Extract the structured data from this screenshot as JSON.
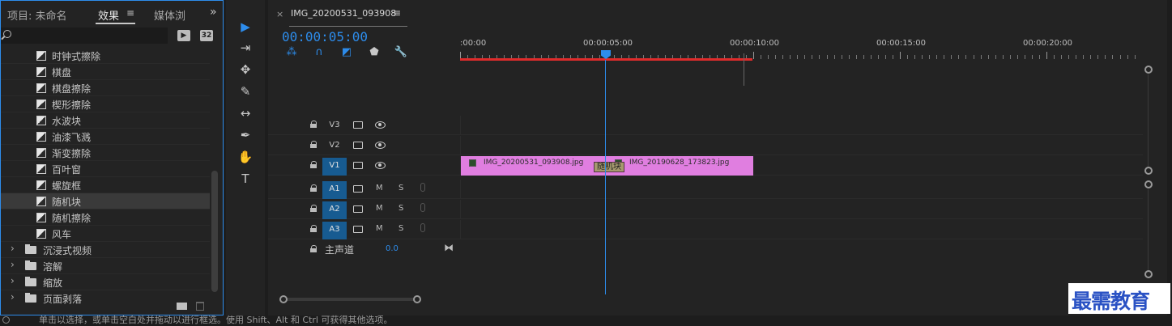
{
  "left_panel": {
    "tabs": [
      {
        "label": "项目: 未命名"
      },
      {
        "label": "效果",
        "menu": "≡"
      },
      {
        "label": "媒体浏"
      }
    ],
    "overflow": "»",
    "search": {
      "value": "",
      "placeholder": ""
    },
    "effects": [
      {
        "label": "时钟式擦除"
      },
      {
        "label": "棋盘"
      },
      {
        "label": "棋盘擦除"
      },
      {
        "label": "楔形擦除"
      },
      {
        "label": "水波块"
      },
      {
        "label": "油漆飞溅"
      },
      {
        "label": "渐变擦除"
      },
      {
        "label": "百叶窗"
      },
      {
        "label": "螺旋框"
      },
      {
        "label": "随机块",
        "selected": true
      },
      {
        "label": "随机擦除"
      },
      {
        "label": "风车"
      }
    ],
    "folders": [
      {
        "label": "沉浸式视频"
      },
      {
        "label": "溶解"
      },
      {
        "label": "缩放"
      },
      {
        "label": "页面剥落"
      }
    ]
  },
  "tools": [
    {
      "name": "selection-tool-icon",
      "glyph": "▶"
    },
    {
      "name": "track-select-tool-icon",
      "glyph": "⇥"
    },
    {
      "name": "ripple-edit-tool-icon",
      "glyph": "✥"
    },
    {
      "name": "razor-tool-icon",
      "glyph": "✎"
    },
    {
      "name": "slip-tool-icon",
      "glyph": "↔"
    },
    {
      "name": "pen-tool-icon",
      "glyph": "✒"
    },
    {
      "name": "hand-tool-icon",
      "glyph": "✋"
    },
    {
      "name": "type-tool-icon",
      "glyph": "T"
    }
  ],
  "timeline": {
    "close": "×",
    "sequence_name": "IMG_20200531_093908",
    "menu": "≡",
    "timecode": "00:00:05:00",
    "ruler_labels": [
      ":00:00",
      "00:00:05:00",
      "00:00:10:00",
      "00:00:15:00",
      "00:00:20:00"
    ],
    "tracks": {
      "v3": "V3",
      "v2": "V2",
      "v1": "V1",
      "a1": "A1",
      "a2": "A2",
      "a3": "A3",
      "mute": "M",
      "solo": "S"
    },
    "master": {
      "label": "主声道",
      "value": "0.0"
    },
    "clips": [
      {
        "name": "IMG_20200531_093908.jpg"
      },
      {
        "name": "IMG_20190628_173823.jpg"
      }
    ],
    "transition": "随机块"
  },
  "colors": {
    "accent": "#2d8ceb",
    "clip": "#e07ee0",
    "work_area": "#e02b2b",
    "target_track": "#175b91"
  },
  "status_bar": {
    "text": "单击以选择，或单击空白处并拖动以进行框选。使用 Shift、Alt 和 Ctrl 可获得其他选项。"
  },
  "watermark": "最需教育"
}
